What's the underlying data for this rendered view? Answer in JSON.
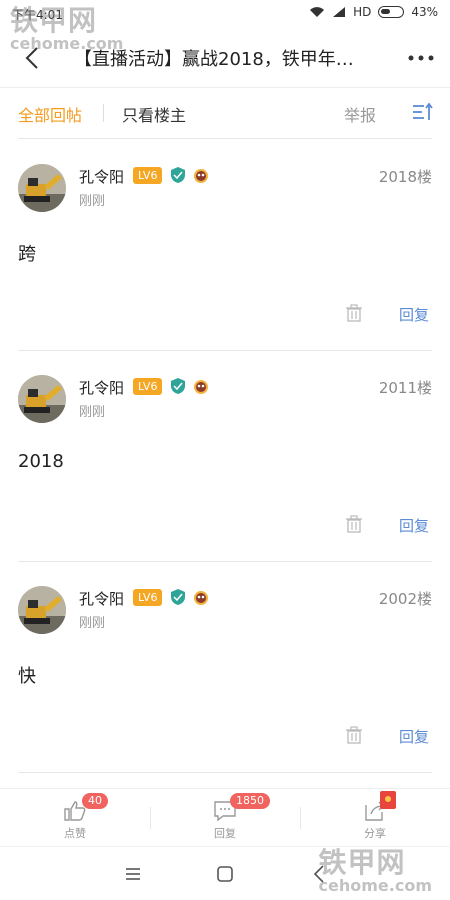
{
  "status_bar": {
    "time": "下午4:01",
    "network": "HD",
    "battery": "43%"
  },
  "watermark": {
    "brand": "铁甲网",
    "domain": "cehome.com"
  },
  "header": {
    "title": "【直播活动】赢战2018，铁甲年…"
  },
  "filters": {
    "all_replies": "全部回帖",
    "owner_only": "只看楼主",
    "report": "举报"
  },
  "colors": {
    "accent": "#f39c1f",
    "link": "#5b8bd4",
    "badge": "#f0635f",
    "level_badge": "#f5a623"
  },
  "posts": [
    {
      "username": "孔令阳",
      "level": "LV6",
      "floor": "2018楼",
      "time": "刚刚",
      "content": "跨",
      "reply_label": "回复"
    },
    {
      "username": "孔令阳",
      "level": "LV6",
      "floor": "2011楼",
      "time": "刚刚",
      "content": "2018",
      "reply_label": "回复"
    },
    {
      "username": "孔令阳",
      "level": "LV6",
      "floor": "2002楼",
      "time": "刚刚",
      "content": "快",
      "reply_label": "回复"
    }
  ],
  "bottom_bar": {
    "like": {
      "label": "点赞",
      "count": "40"
    },
    "reply": {
      "label": "回复",
      "count": "1850"
    },
    "share": {
      "label": "分享"
    }
  },
  "icons": [
    "back-icon",
    "more-icon",
    "sort-icon",
    "verified-shield-icon",
    "mascot-icon",
    "trash-icon",
    "thumbs-up-icon",
    "comment-icon",
    "share-icon",
    "red-envelope-icon",
    "menu-icon",
    "home-icon",
    "nav-back-icon",
    "wifi-icon",
    "signal-icon",
    "battery-icon"
  ]
}
